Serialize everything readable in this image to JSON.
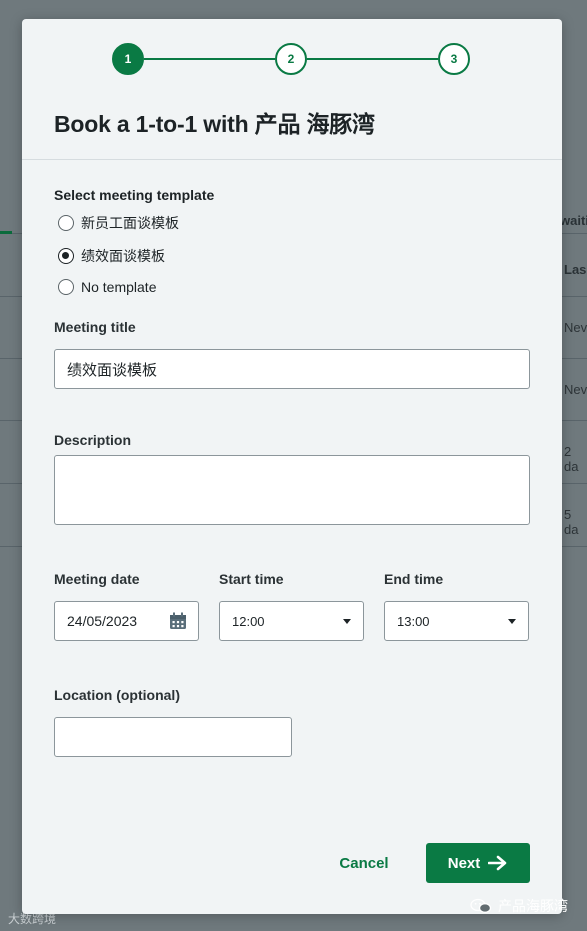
{
  "background": {
    "column_header_1": "waiti",
    "column_header_2": "Las",
    "rows": [
      "Nev",
      "Nev",
      "2 da",
      "5 da"
    ],
    "watermark_left": "大数跨境"
  },
  "modal": {
    "title": "Book a 1-to-1 with 产品 海豚湾",
    "steps": [
      "1",
      "2",
      "3"
    ],
    "active_step": 1,
    "template_section": {
      "label": "Select meeting template",
      "options": [
        "新员工面谈模板",
        "绩效面谈模板",
        "No template"
      ],
      "selected_index": 1
    },
    "meeting_title": {
      "label": "Meeting title",
      "value": "绩效面谈模板"
    },
    "description": {
      "label": "Description",
      "value": ""
    },
    "meeting_date": {
      "label": "Meeting date",
      "value": "24/05/2023"
    },
    "start_time": {
      "label": "Start time",
      "value": "12:00"
    },
    "end_time": {
      "label": "End time",
      "value": "13:00"
    },
    "location": {
      "label": "Location (optional)",
      "value": ""
    },
    "cancel_label": "Cancel",
    "next_label": "Next"
  },
  "watermark_right": "产品海豚湾",
  "colors": {
    "primary": "#0a7a44",
    "modal_bg": "#f1f4f5",
    "overlay": "#626c70"
  },
  "icons": [
    "calendar-icon",
    "chevron-down-icon",
    "arrow-right-icon",
    "wechat-icon"
  ]
}
